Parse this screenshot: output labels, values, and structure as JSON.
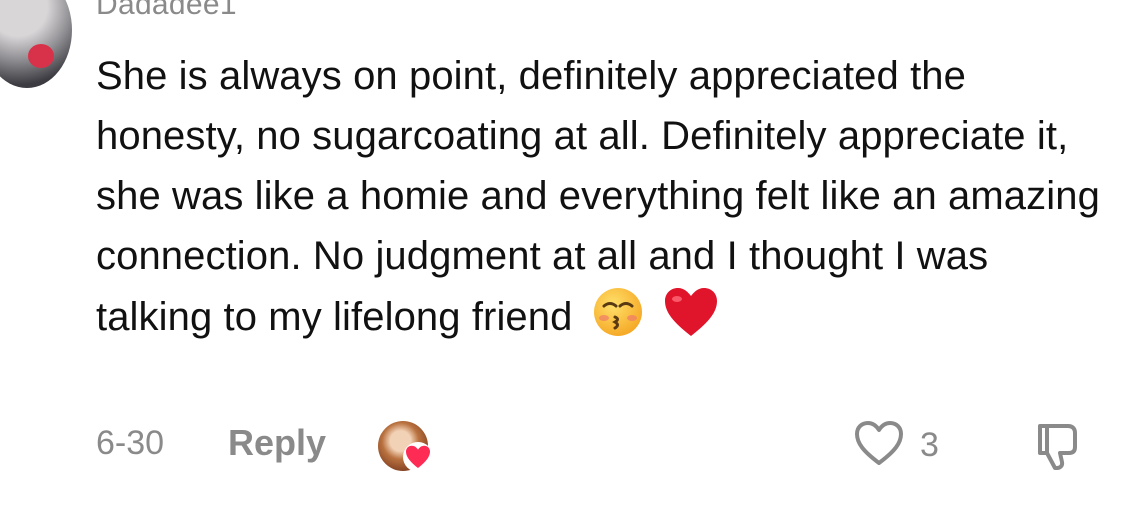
{
  "comment": {
    "username": "Dadadee1",
    "text": "She is always on point, definitely appreciated the honesty, no sugarcoating at all. Definitely appreciate it, she was like a homie and everything felt like an amazing connection. No judgment at all and I thought I was talking to my lifelong friend",
    "date": "6-30",
    "reply_label": "Reply",
    "like_count": "3"
  },
  "icons": {
    "emoji_1": "kissing-face-closed-eyes-icon",
    "emoji_2": "red-heart-icon",
    "like": "heart-outline-icon",
    "dislike": "thumbs-down-icon",
    "creator_liked": "pink-heart-icon"
  },
  "colors": {
    "text": "#111111",
    "muted": "#8a8a8a",
    "heart_red": "#e0142a",
    "creator_heart": "#fe2c55"
  }
}
